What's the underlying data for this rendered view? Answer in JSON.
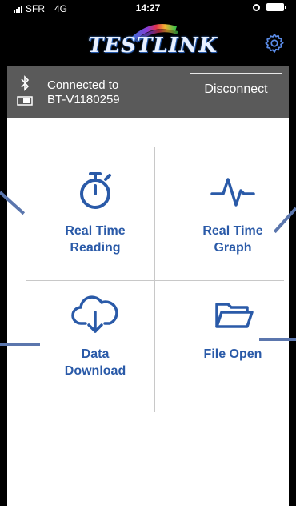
{
  "status_bar": {
    "carrier": "SFR",
    "network": "4G",
    "time": "14:27"
  },
  "header": {
    "logo_text": "TESTLINK"
  },
  "connection": {
    "status_label": "Connected to",
    "device_name": "BT-V1180259",
    "disconnect_label": "Disconnect"
  },
  "menu": {
    "realtime_reading": {
      "line1": "Real Time",
      "line2": "Reading"
    },
    "realtime_graph": {
      "line1": "Real Time",
      "line2": "Graph"
    },
    "data_download": {
      "line1": "Data",
      "line2": "Download"
    },
    "file_open": {
      "line1": "File Open"
    }
  },
  "colors": {
    "accent": "#2a5aa8",
    "connection_bar": "#5a5a5a",
    "header": "#000000",
    "pointer": "#5b76ad"
  }
}
